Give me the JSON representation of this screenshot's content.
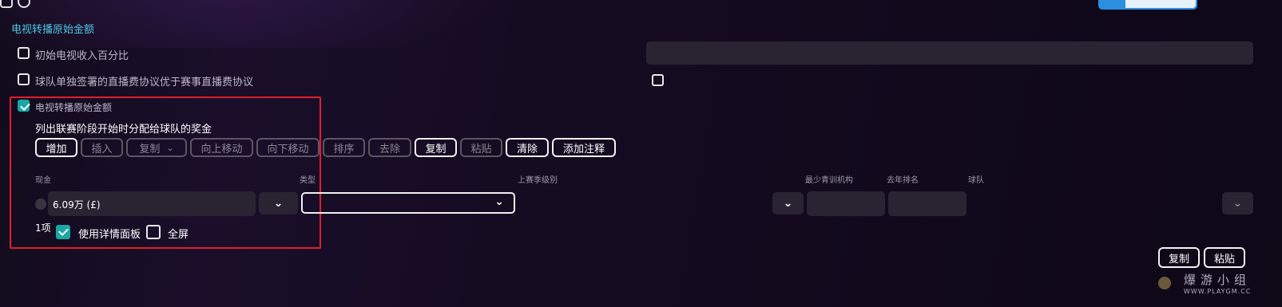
{
  "section_header": "电视转播原始金额",
  "options": {
    "initial_tv_pct": "初始电视收入百分比",
    "team_deal_priority": "球队单独签署的直播费协议优于赛事直播费协议",
    "tv_raw_amount": "电视转播原始金额"
  },
  "group_desc": "列出联赛阶段开始时分配给球队的奖金",
  "toolbar": {
    "add": "增加",
    "insert": "插入",
    "copy_dd": "复制",
    "move_up": "向上移动",
    "move_down": "向下移动",
    "sort": "排序",
    "remove": "去除",
    "copy": "复制",
    "paste": "粘贴",
    "clear": "清除",
    "add_note": "添加注释"
  },
  "columns": {
    "cash": "现金",
    "type": "类型",
    "last_season_level": "上赛季级别",
    "min_youth": "最少青训机构",
    "last_year_rank": "去年排名",
    "team": "球队"
  },
  "row": {
    "cash_value": "6.09万 (£)",
    "type_value": ""
  },
  "footer": {
    "count": "1项",
    "use_detail_panel": "使用详情面板",
    "fullscreen": "全屏"
  },
  "bottom_buttons": {
    "copy": "复制",
    "paste": "粘贴"
  },
  "watermark": {
    "text": "爆游小组",
    "url": "WWW.PLAYGM.CC"
  },
  "colors": {
    "accent_teal": "#1aa6a6",
    "section_cyan": "#4fc7e0",
    "highlight_red": "#e0202a"
  }
}
